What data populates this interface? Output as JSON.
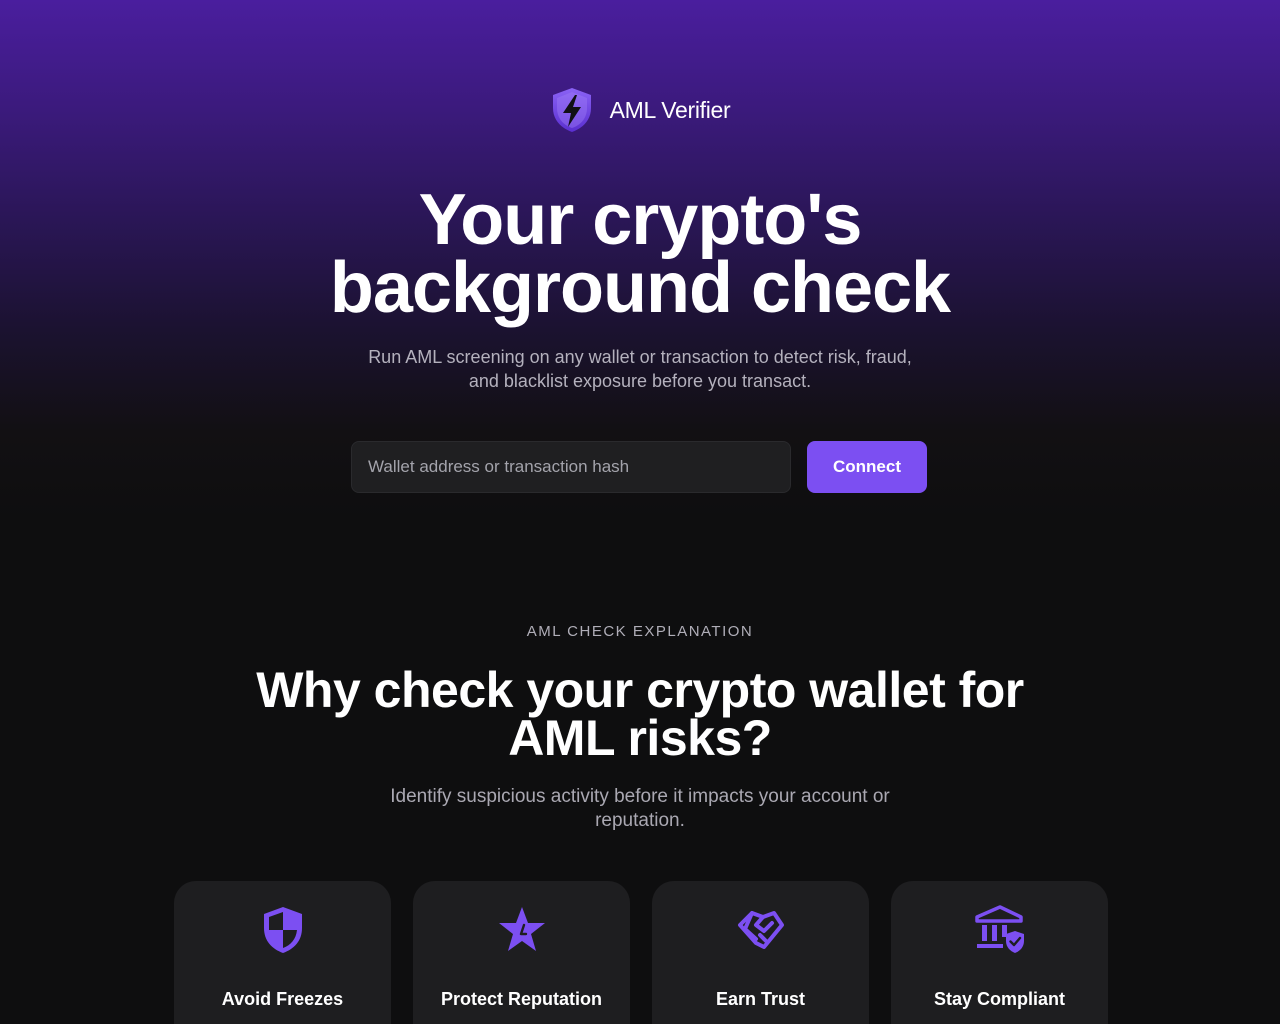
{
  "brand": {
    "name": "AML Verifier",
    "logo_icon": "shield-lightning-icon"
  },
  "hero": {
    "title_lines": [
      "Your crypto's",
      "background check"
    ],
    "subtitle_lines": [
      "Run AML screening on any wallet or transaction to detect risk, fraud,",
      "and blacklist exposure before you transact."
    ],
    "search": {
      "placeholder": "Wallet address or transaction hash",
      "value": ""
    },
    "connect_label": "Connect"
  },
  "explanation": {
    "eyebrow": "AML CHECK EXPLANATION",
    "title_lines": [
      "Why check your crypto wallet for",
      "AML risks?"
    ],
    "subtitle_lines": [
      "Identify suspicious activity before it impacts your account or",
      "reputation."
    ],
    "cards": [
      {
        "title": "Avoid Freezes",
        "icon": "shield-icon"
      },
      {
        "title": "Protect Reputation",
        "icon": "star-icon"
      },
      {
        "title": "Earn Trust",
        "icon": "handshake-icon"
      },
      {
        "title": "Stay Compliant",
        "icon": "bank-check-icon"
      }
    ]
  },
  "colors": {
    "accent": "#7c4ff2",
    "background": "#0e0e0f",
    "card": "#1e1e20",
    "gradient_top": "#4a1e9e"
  }
}
